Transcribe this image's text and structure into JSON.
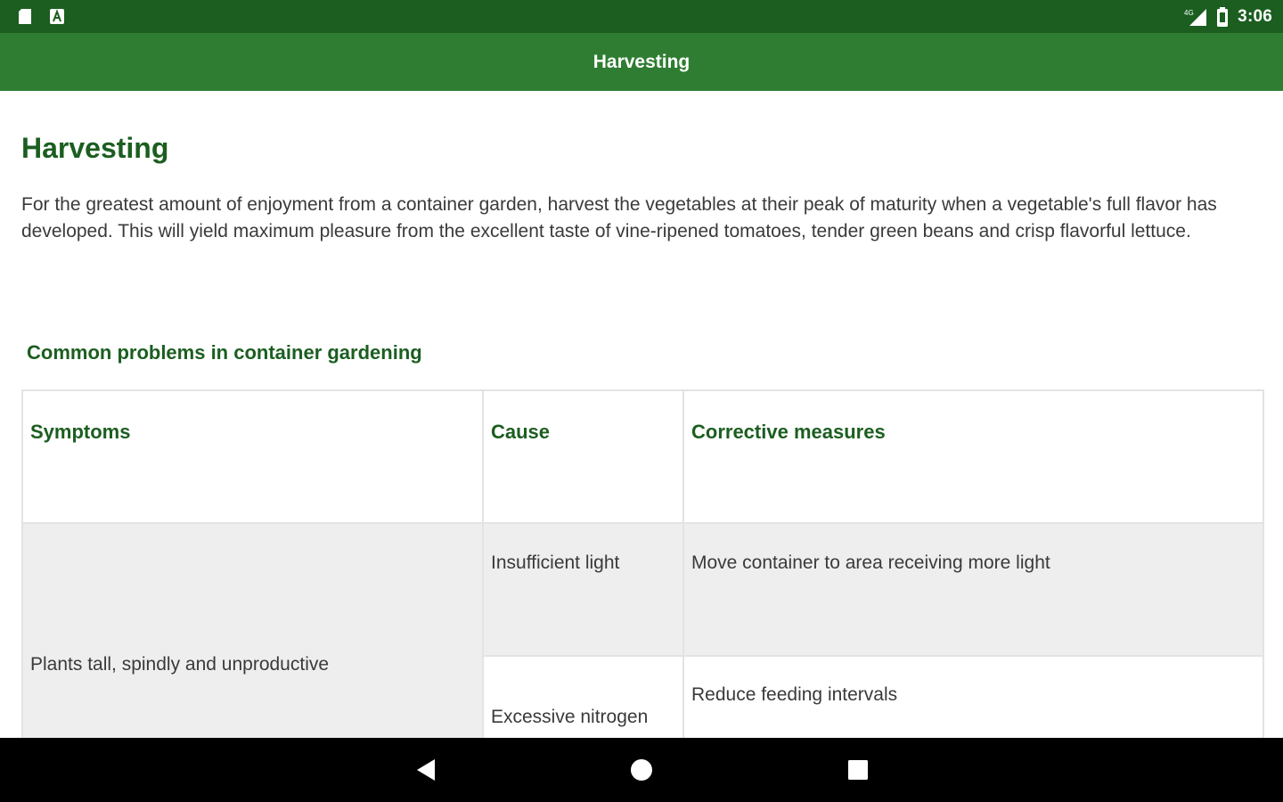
{
  "status_bar": {
    "time": "3:06",
    "network_label": "4G",
    "icons": [
      "sd-card-icon",
      "a-icon",
      "signal-icon",
      "battery-icon"
    ]
  },
  "toolbar": {
    "title": "Harvesting"
  },
  "article": {
    "heading": "Harvesting",
    "intro": "For the greatest amount of enjoyment from a container garden, harvest the vegetables at their peak of maturity when a vegetable's full flavor has developed. This will yield maximum pleasure from the excellent taste of vine-ripened tomatoes, tender green beans and crisp flavorful lettuce.",
    "section_heading": "Common problems in container gardening",
    "table": {
      "headers": [
        "Symptoms",
        "Cause",
        "Corrective measures"
      ],
      "rows": [
        {
          "symptom": "Plants tall, spindly and unproductive",
          "causes": [
            {
              "cause": "Insufficient light",
              "measure": "Move container to area receiving more light"
            },
            {
              "cause": "Excessive nitrogen",
              "measure": "Reduce feeding intervals"
            }
          ]
        }
      ]
    }
  },
  "nav_bar": {
    "buttons": [
      "back-icon",
      "home-icon",
      "recents-icon"
    ]
  },
  "colors": {
    "status_bar": "#1b5e20",
    "toolbar": "#2e7d32",
    "heading_green": "#1b5e20",
    "row_shade": "#eeeeee"
  }
}
